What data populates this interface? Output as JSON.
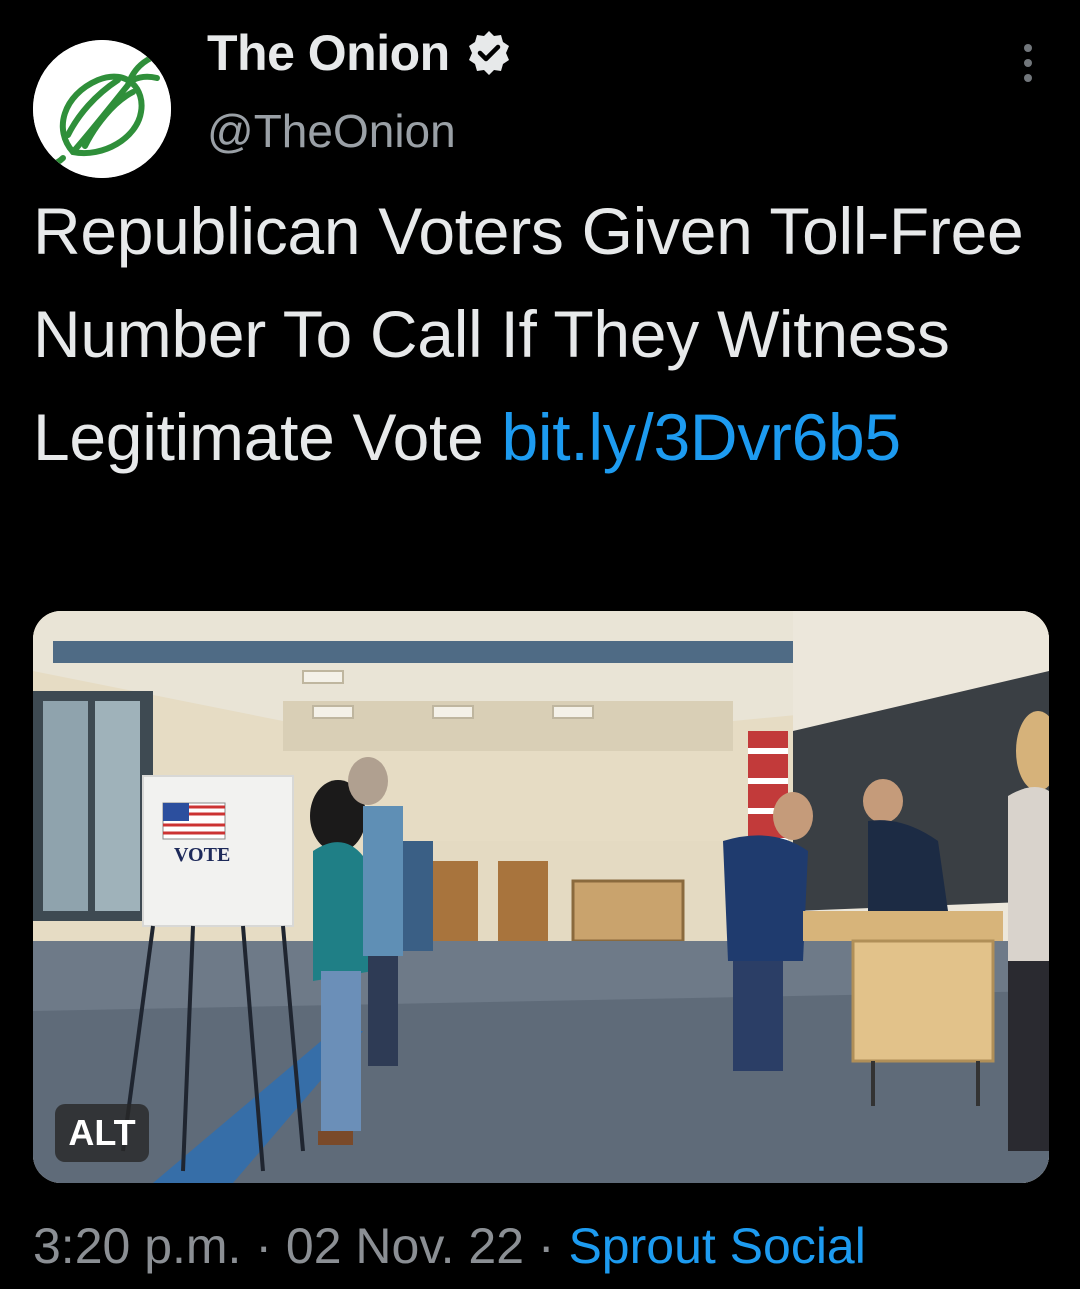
{
  "tweet": {
    "display_name": "The Onion",
    "handle": "@TheOnion",
    "verified_icon": "verified-badge-icon",
    "more_icon": "more-options-icon",
    "text": "Republican Voters Given Toll-Free Number To Call If They Witness Legitimate Vote ",
    "link": "bit.ly/3Dvr6b5",
    "media": {
      "booth_sign": "VOTE",
      "alt_label": "ALT"
    },
    "time": "3:20 p.m.",
    "sep1": " · ",
    "date": "02 Nov. 22",
    "sep2": " · ",
    "source": "Sprout Social"
  },
  "colors": {
    "background": "#000000",
    "text": "#e7e9ea",
    "muted": "#8b8f94",
    "link": "#1d9bf0",
    "onion_green": "#2f8f3a"
  }
}
